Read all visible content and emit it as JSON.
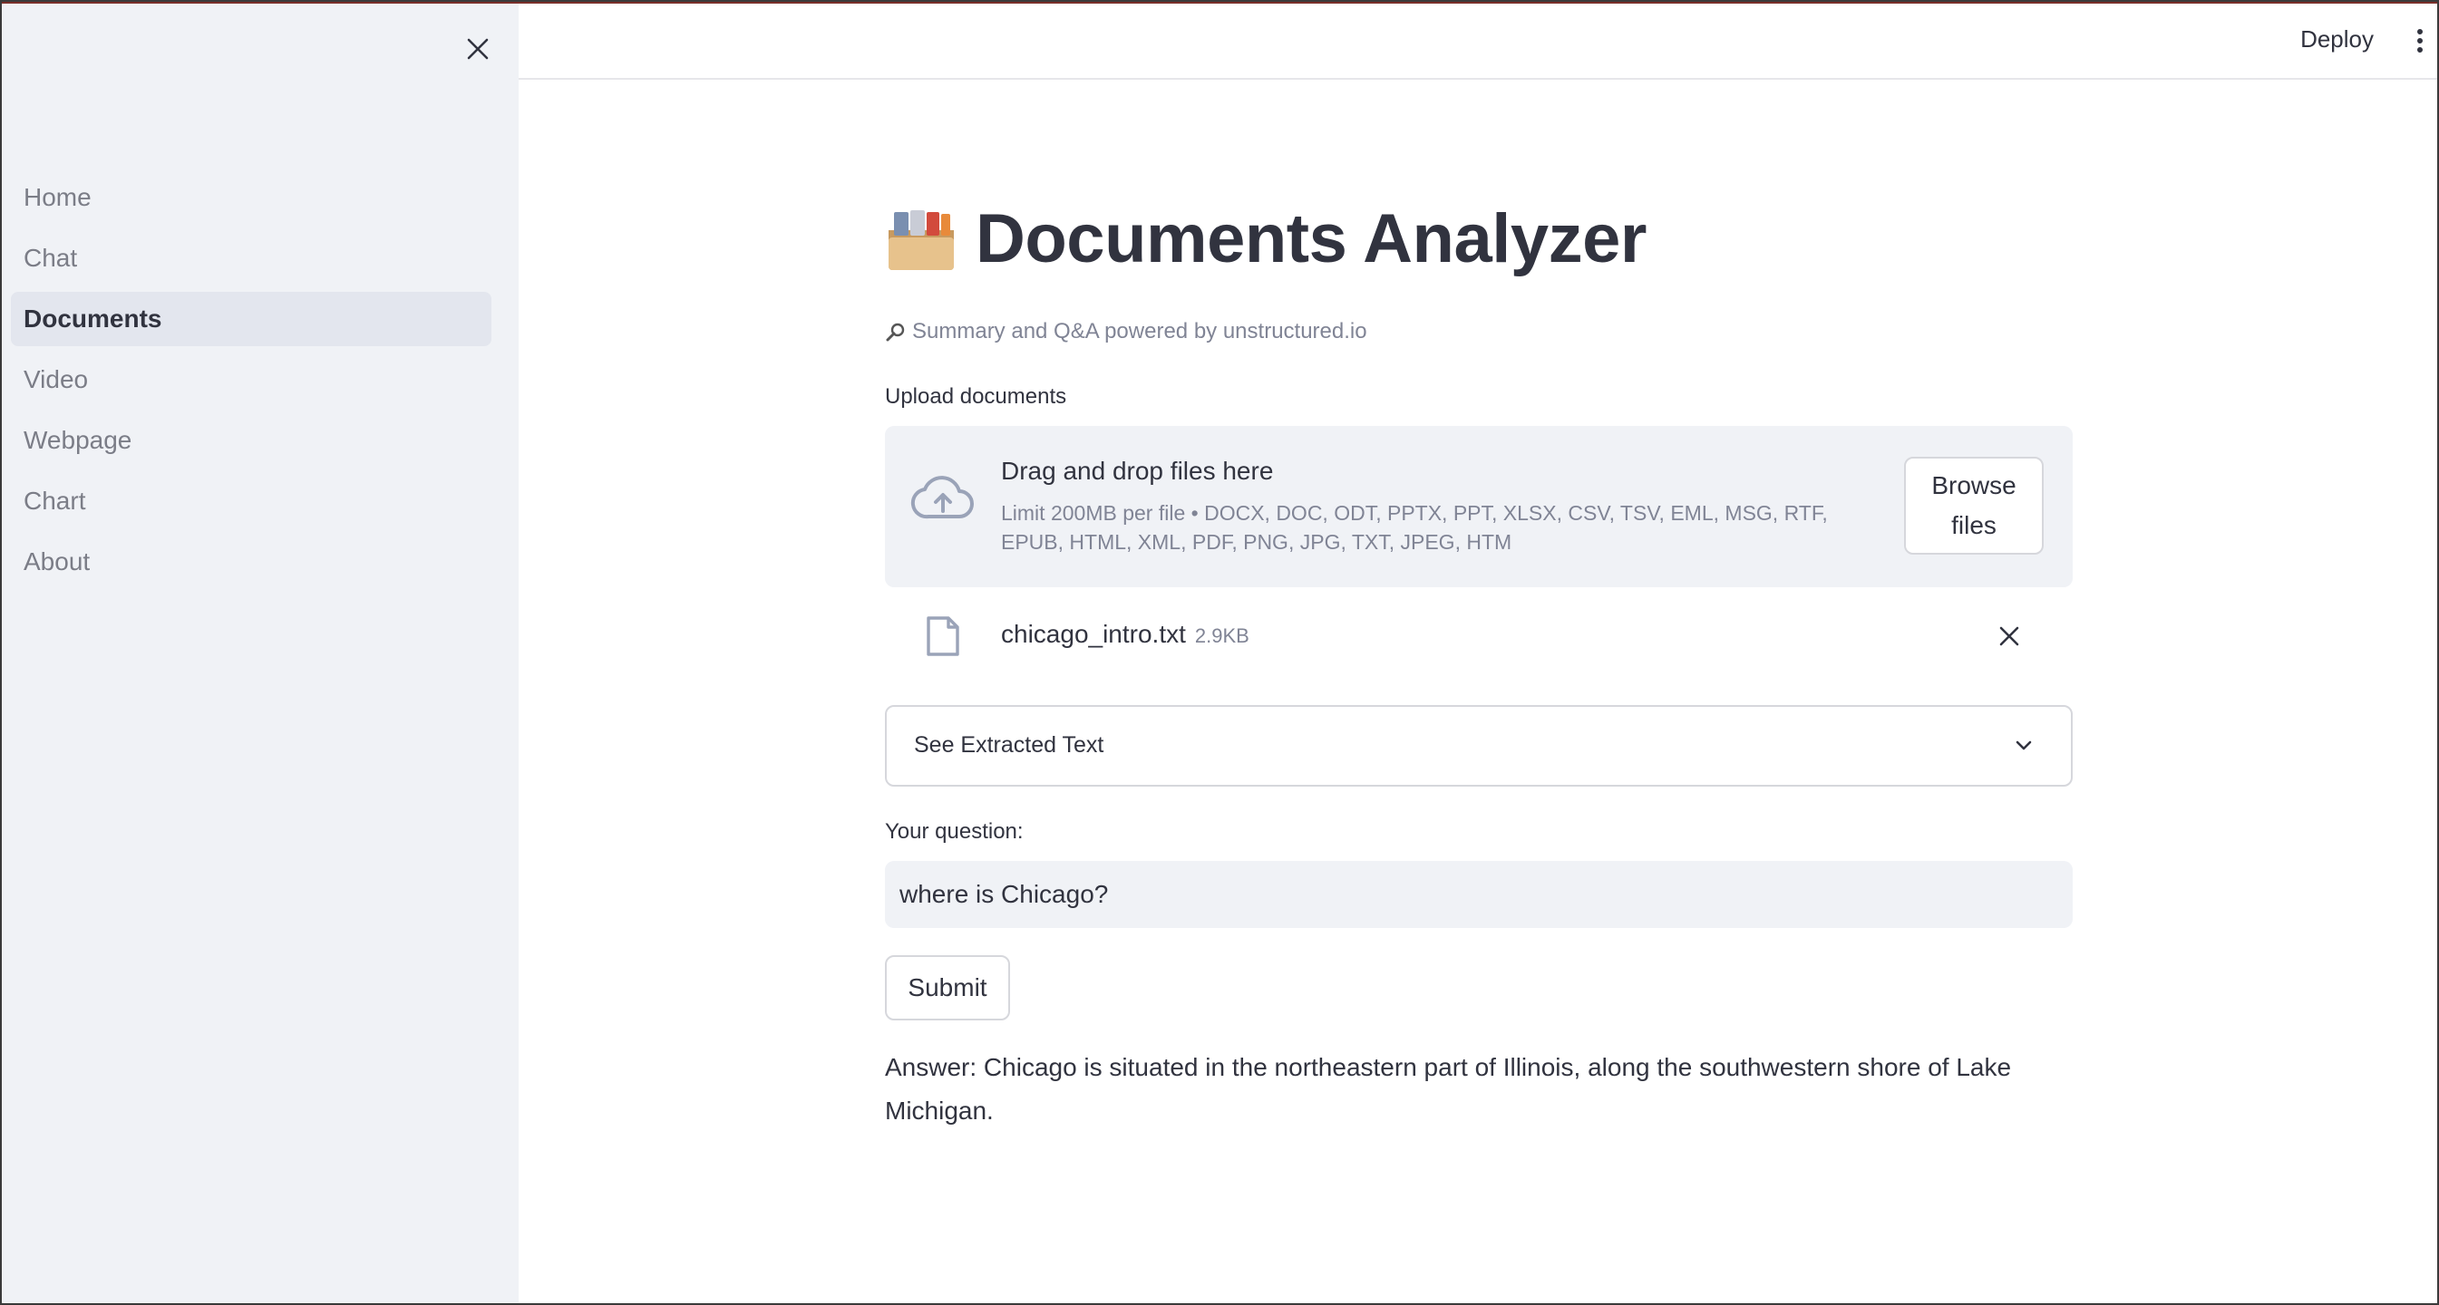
{
  "sidebar": {
    "items": [
      {
        "label": "Home"
      },
      {
        "label": "Chat"
      },
      {
        "label": "Documents",
        "active": true
      },
      {
        "label": "Video"
      },
      {
        "label": "Webpage"
      },
      {
        "label": "Chart"
      },
      {
        "label": "About"
      }
    ]
  },
  "header": {
    "deploy_label": "Deploy"
  },
  "main": {
    "title_icon": "card-file-box-icon",
    "title": "Documents Analyzer",
    "caption": "Summary and Q&A powered by unstructured.io",
    "upload": {
      "label": "Upload documents",
      "dropzone_title": "Drag and drop files here",
      "limit_text": "Limit 200MB per file • DOCX, DOC, ODT, PPTX, PPT, XLSX, CSV, TSV, EML, MSG, RTF, EPUB, HTML, XML, PDF, PNG, JPG, TXT, JPEG, HTM",
      "browse_label": "Browse files"
    },
    "file": {
      "name": "chicago_intro.txt",
      "size": "2.9KB"
    },
    "expander_label": "See Extracted Text",
    "question": {
      "label": "Your question:",
      "value": "where is Chicago?"
    },
    "submit_label": "Submit",
    "answer": "Answer: Chicago is situated in the northeastern part of Illinois, along the southwestern shore of Lake Michigan."
  },
  "colors": {
    "sidebar_bg": "#f0f2f6",
    "text": "#31333f",
    "muted": "#808495"
  }
}
